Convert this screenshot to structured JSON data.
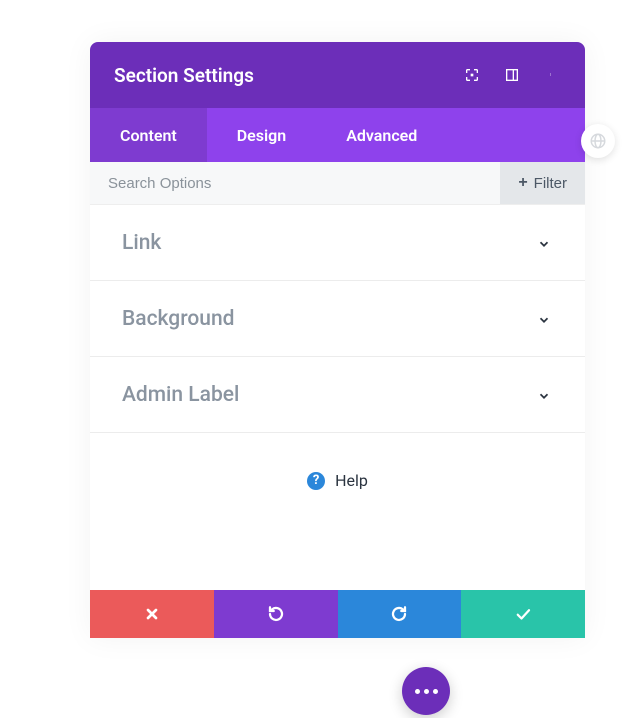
{
  "header": {
    "title": "Section Settings"
  },
  "tabs": {
    "items": [
      {
        "label": "Content",
        "active": true
      },
      {
        "label": "Design",
        "active": false
      },
      {
        "label": "Advanced",
        "active": false
      }
    ]
  },
  "filterbar": {
    "search_placeholder": "Search Options",
    "filter_label": "Filter"
  },
  "options": [
    {
      "title": "Link"
    },
    {
      "title": "Background"
    },
    {
      "title": "Admin Label"
    }
  ],
  "help": {
    "label": "Help"
  },
  "colors": {
    "header": "#6c2eb9",
    "tabs": "#8e42ec",
    "tab_active": "#7e3bd0",
    "cancel": "#eb5a5a",
    "undo": "#7e3bd0",
    "redo": "#2b87da",
    "save": "#29c4a9"
  }
}
